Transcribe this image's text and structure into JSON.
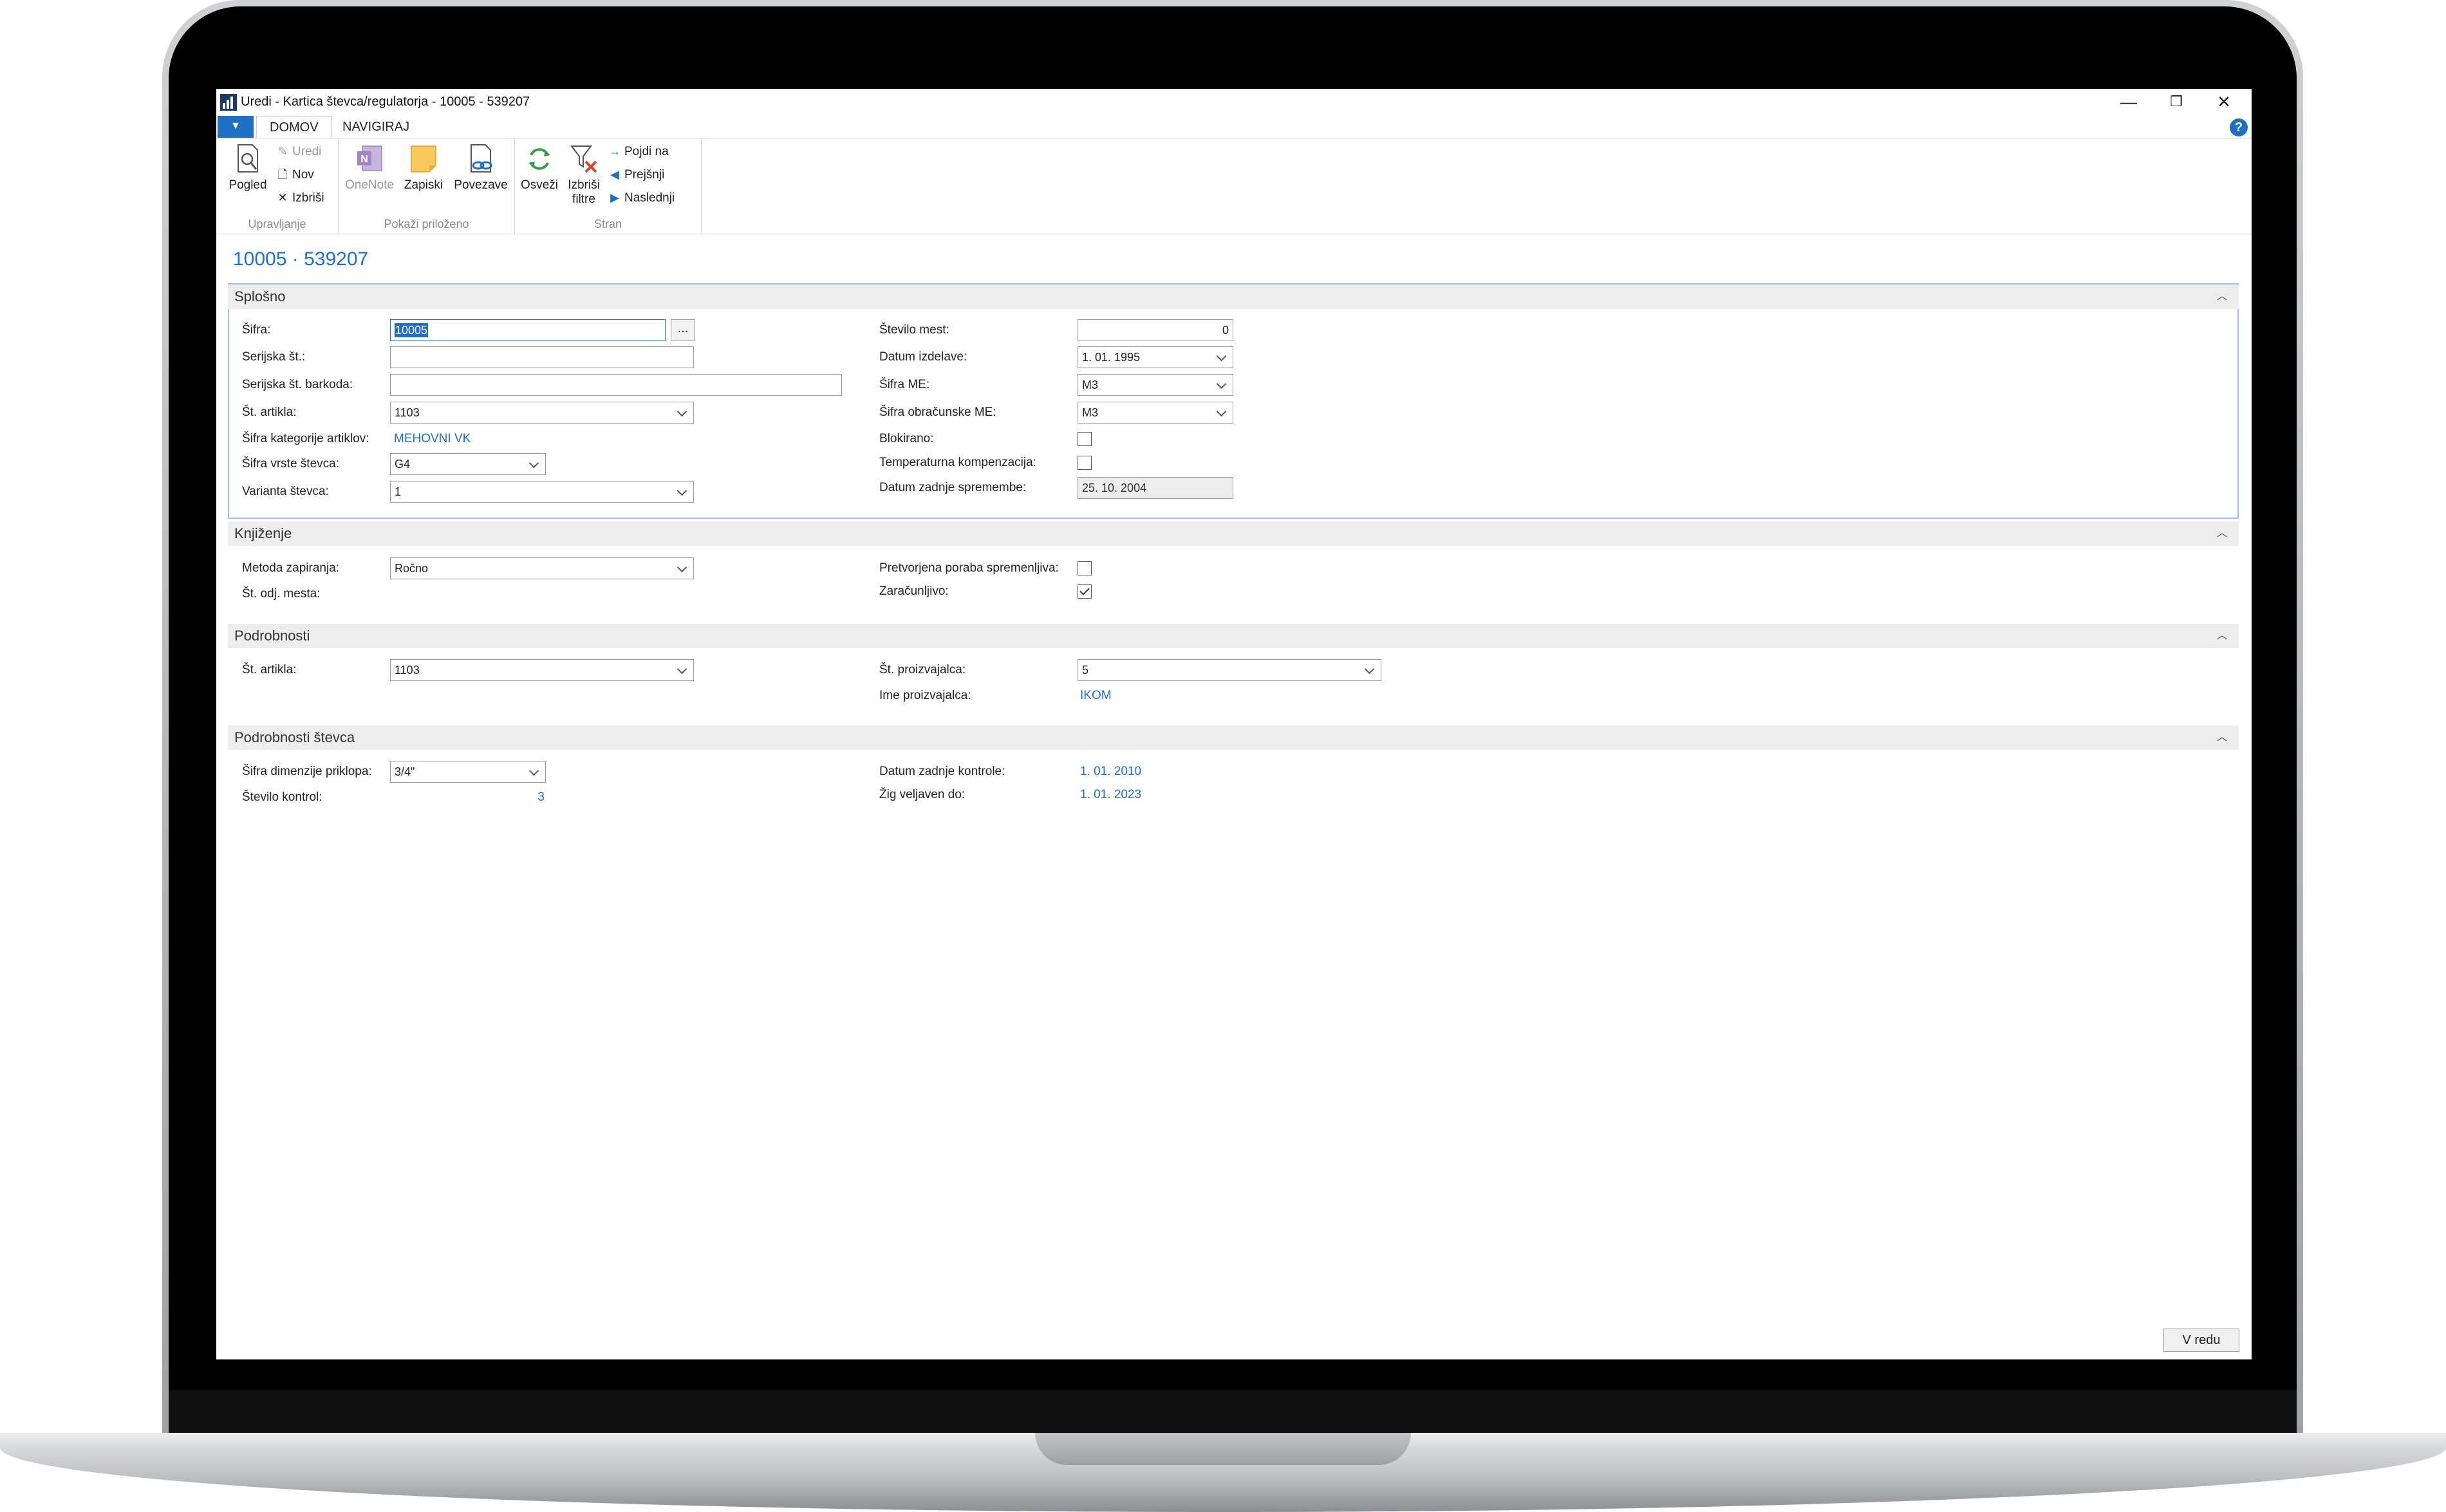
{
  "window": {
    "title": "Uredi - Kartica števca/regulatorja - 10005 - 539207",
    "minimize_glyph": "—",
    "restore_glyph": "❐",
    "close_glyph": "✕"
  },
  "tabs": {
    "file_glyph": "▼",
    "items": [
      {
        "label": "DOMOV",
        "active": true
      },
      {
        "label": "NAVIGIRAJ",
        "active": false
      }
    ],
    "help_glyph": "?"
  },
  "ribbon": {
    "groups": [
      {
        "label": "Upravljanje",
        "buttons": [
          {
            "label": "Pogled",
            "icon": "view-icon"
          },
          {
            "label": "Uredi",
            "icon": "pencil-icon",
            "disabled": true
          },
          {
            "label": "Nov",
            "icon": "new-document-icon"
          },
          {
            "label": "Izbriši",
            "icon": "delete-x-icon"
          }
        ]
      },
      {
        "label": "Pokaži priloženo",
        "buttons": [
          {
            "label": "OneNote",
            "icon": "onenote-icon",
            "disabled": true
          },
          {
            "label": "Zapiski",
            "icon": "note-icon"
          },
          {
            "label": "Povezave",
            "icon": "link-icon"
          }
        ]
      },
      {
        "label": "Stran",
        "buttons": [
          {
            "label": "Osveži",
            "icon": "refresh-icon"
          },
          {
            "label": "Izbriši\nfiltre",
            "icon": "clear-filter-icon"
          },
          {
            "label": "Pojdi na",
            "icon": "arrow-right-icon"
          },
          {
            "label": "Prejšnji",
            "icon": "previous-icon"
          },
          {
            "label": "Naslednji",
            "icon": "next-icon"
          }
        ]
      }
    ]
  },
  "page_title": "10005 · 539207",
  "sections": {
    "splosno": {
      "title": "Splošno",
      "fields": {
        "sifra": {
          "label": "Šifra:",
          "value": "10005",
          "ellipsis": "..."
        },
        "serijska_st": {
          "label": "Serijska št.:",
          "value": ""
        },
        "serijska_barkoda": {
          "label": "Serijska št. barkoda:",
          "value": ""
        },
        "st_artikla": {
          "label": "Št. artikla:",
          "value": "1103"
        },
        "sifra_kategorije": {
          "label": "Šifra kategorije artiklov:",
          "value": "MEHOVNI VK"
        },
        "sifra_vrste": {
          "label": "Šifra vrste števca:",
          "value": "G4"
        },
        "varianta": {
          "label": "Varianta števca:",
          "value": "1"
        },
        "stevilo_mest": {
          "label": "Število mest:",
          "value": "0"
        },
        "datum_izdelave": {
          "label": "Datum izdelave:",
          "value": "1. 01. 1995"
        },
        "sifra_me": {
          "label": "Šifra ME:",
          "value": "M3"
        },
        "sifra_obracunske_me": {
          "label": "Šifra obračunske ME:",
          "value": "M3"
        },
        "blokirano": {
          "label": "Blokirano:",
          "checked": false
        },
        "temperaturna": {
          "label": "Temperaturna kompenzacija:",
          "checked": false
        },
        "datum_zadnje_spremembe": {
          "label": "Datum zadnje spremembe:",
          "value": "25. 10. 2004"
        }
      }
    },
    "knjizenje": {
      "title": "Knjiženje",
      "fields": {
        "metoda_zapiranja": {
          "label": "Metoda zapiranja:",
          "value": "Ročno"
        },
        "st_odj_mesta": {
          "label": "Št. odj. mesta:"
        },
        "pretvorjena_poraba": {
          "label": "Pretvorjena poraba spremenljiva:",
          "checked": false
        },
        "zaracunljivo": {
          "label": "Zaračunljivo:",
          "checked": true
        }
      }
    },
    "podrobnosti": {
      "title": "Podrobnosti",
      "fields": {
        "st_artikla": {
          "label": "Št. artikla:",
          "value": "1103"
        },
        "st_proizvajalca": {
          "label": "Št. proizvajalca:",
          "value": "5"
        },
        "ime_proizvajalca": {
          "label": "Ime proizvajalca:",
          "value": "IKOM"
        }
      }
    },
    "podrobnosti_stevca": {
      "title": "Podrobnosti števca",
      "fields": {
        "sifra_dimenzije": {
          "label": "Šifra dimenzije priklopa:",
          "value": "3/4\""
        },
        "stevilo_kontrol": {
          "label": "Število kontrol:",
          "value": "3"
        },
        "datum_zadnje_kontrole": {
          "label": "Datum zadnje kontrole:",
          "value": "1. 01. 2010"
        },
        "zig_veljaven": {
          "label": "Žig veljaven do:",
          "value": "1. 01. 2023"
        }
      }
    }
  },
  "collapse_glyph": "︿",
  "footer": {
    "ok_label": "V redu"
  },
  "colors": {
    "accent": "#1f6fc5",
    "section_header_bg": "#ededed",
    "section_border": "#9ec3ea"
  }
}
